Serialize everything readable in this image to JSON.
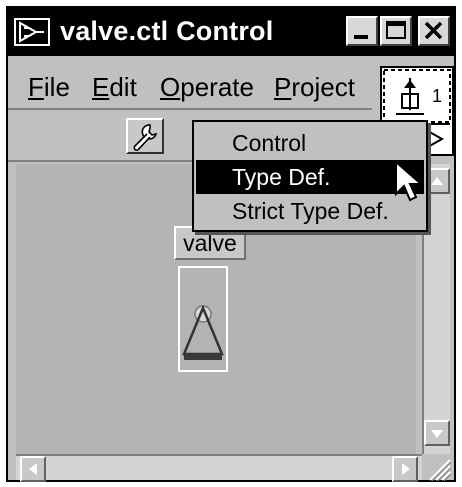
{
  "window": {
    "title": "valve.ctl Control"
  },
  "menubar": {
    "items": [
      {
        "label_first": "F",
        "label_rest": "ile"
      },
      {
        "label_first": "E",
        "label_rest": "dit"
      },
      {
        "label_first": "O",
        "label_rest": "perate"
      },
      {
        "label_first": "P",
        "label_rest": "roject"
      }
    ]
  },
  "connector_pane": {
    "terminal_number": "1"
  },
  "dropdown": {
    "items": [
      {
        "label": "Control",
        "selected": false
      },
      {
        "label": "Type Def.",
        "selected": true
      },
      {
        "label": "Strict Type Def.",
        "selected": false
      }
    ]
  },
  "control": {
    "label": "valve"
  },
  "icons": {
    "title": "labview-vi-icon",
    "toolbar": "wrench-icon",
    "cursor": "arrow-cursor-icon"
  }
}
